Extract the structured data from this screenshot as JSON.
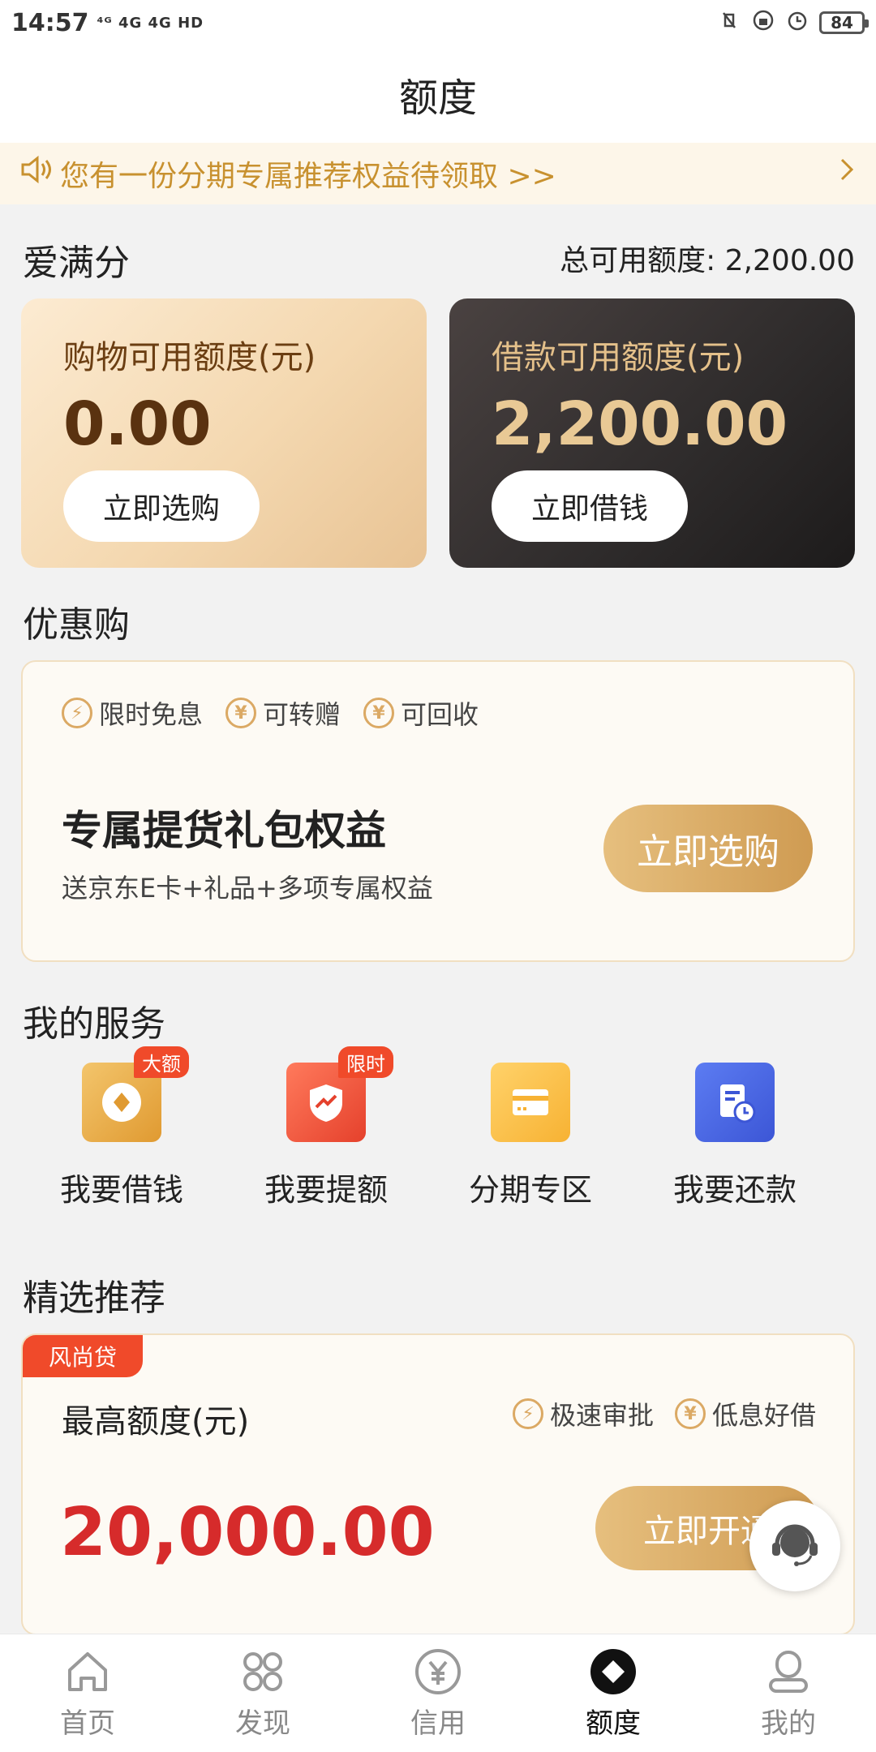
{
  "status": {
    "time": "14:57",
    "network": "⁴ᴳ 4G 4G HD",
    "battery": "84"
  },
  "header": {
    "title": "额度"
  },
  "notice": {
    "text": "您有一份分期专属推荐权益待领取 >>"
  },
  "credit": {
    "section_title": "爱满分",
    "total": "总可用额度: 2,200.00",
    "shopping": {
      "label": "购物可用额度(元)",
      "amount": "0.00",
      "button": "立即选购"
    },
    "loan": {
      "label": "借款可用额度(元)",
      "amount": "2,200.00",
      "button": "立即借钱"
    }
  },
  "promo": {
    "section_title": "优惠购",
    "tags": [
      "限时免息",
      "可转赠",
      "可回收"
    ],
    "title": "专属提货礼包权益",
    "subtitle": "送京东E卡+礼品+多项专属权益",
    "button": "立即选购"
  },
  "services": {
    "section_title": "我的服务",
    "items": [
      {
        "label": "我要借钱",
        "badge": "大额"
      },
      {
        "label": "我要提额",
        "badge": "限时"
      },
      {
        "label": "分期专区",
        "badge": ""
      },
      {
        "label": "我要还款",
        "badge": ""
      }
    ]
  },
  "recommend": {
    "section_title": "精选推荐",
    "ribbon": "风尚贷",
    "label": "最高额度(元)",
    "tags": [
      "极速审批",
      "低息好借"
    ],
    "amount": "20,000.00",
    "button": "立即开通"
  },
  "tabbar": {
    "items": [
      {
        "label": "首页"
      },
      {
        "label": "发现"
      },
      {
        "label": "信用"
      },
      {
        "label": "额度"
      },
      {
        "label": "我的"
      }
    ]
  },
  "colors": {
    "accent_gold": "#cf9b52",
    "notice_text": "#c8912f",
    "amount_red": "#d62b2b",
    "badge_red": "#f04a2a"
  }
}
